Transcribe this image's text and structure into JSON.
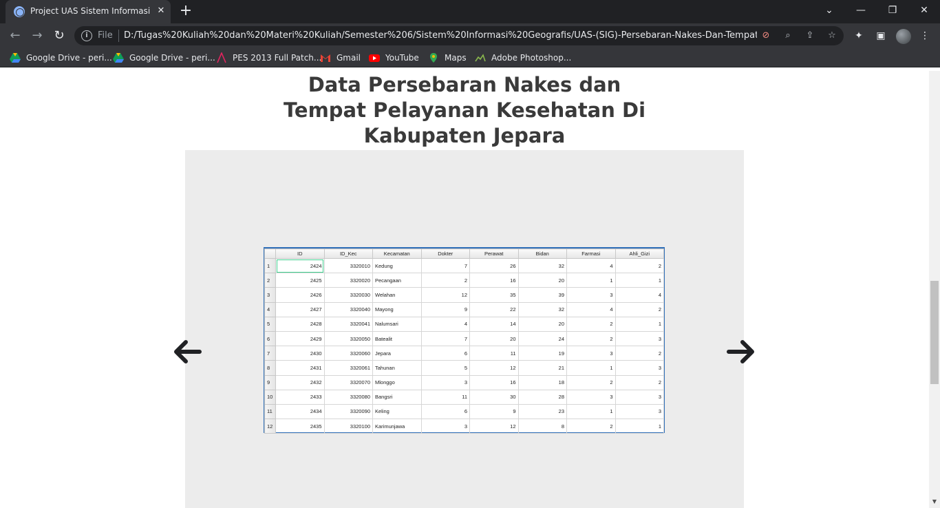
{
  "browser": {
    "tab_title": "Project UAS Sistem Informasi Geografis",
    "close_glyph": "✕",
    "new_tab_glyph": "+",
    "url_scheme": "File",
    "url": "D:/Tugas%20Kuliah%20dan%20Materi%20Kuliah/Semester%206/Sistem%20Informasi%20Geografis/UAS-(SIG)-Persebaran-Nakes-Dan-Tempat-Pelayanan-Kesehatan/index.html",
    "bookmarks": [
      {
        "label": "Google Drive - peri...",
        "icon": "google-drive-icon"
      },
      {
        "label": "Google Drive - peri...",
        "icon": "google-drive-icon"
      },
      {
        "label": "PES 2013 Full Patch...",
        "icon": "pes-icon"
      },
      {
        "label": "Gmail",
        "icon": "gmail-icon"
      },
      {
        "label": "YouTube",
        "icon": "youtube-icon"
      },
      {
        "label": "Maps",
        "icon": "maps-icon"
      },
      {
        "label": "Adobe Photoshop...",
        "icon": "photoshop-icon"
      }
    ],
    "accent": "#8ab4f8"
  },
  "page": {
    "heading": "Data Persebaran Nakes dan Tempat Pelayanan Kesehatan Di Kabupaten Jepara",
    "carousel_prev_icon": "arrow-left-icon",
    "carousel_next_icon": "arrow-right-icon"
  },
  "table": {
    "columns": [
      "ID",
      "ID_Kec",
      "Kecamatan",
      "Dokter",
      "Perawat",
      "Bidan",
      "Farmasi",
      "Ahli_Gizi"
    ],
    "rows": [
      [
        "1",
        "2424",
        "3320010",
        "Kedung",
        "7",
        "26",
        "32",
        "4",
        "2"
      ],
      [
        "2",
        "2425",
        "3320020",
        "Pecangaan",
        "2",
        "16",
        "20",
        "1",
        "1"
      ],
      [
        "3",
        "2426",
        "3320030",
        "Welahan",
        "12",
        "35",
        "39",
        "3",
        "4"
      ],
      [
        "4",
        "2427",
        "3320040",
        "Mayong",
        "9",
        "22",
        "32",
        "4",
        "2"
      ],
      [
        "5",
        "2428",
        "3320041",
        "Nalumsari",
        "4",
        "14",
        "20",
        "2",
        "1"
      ],
      [
        "6",
        "2429",
        "3320050",
        "Batealit",
        "7",
        "20",
        "24",
        "2",
        "3"
      ],
      [
        "7",
        "2430",
        "3320060",
        "Jepara",
        "6",
        "11",
        "19",
        "3",
        "2"
      ],
      [
        "8",
        "2431",
        "3320061",
        "Tahunan",
        "5",
        "12",
        "21",
        "1",
        "3"
      ],
      [
        "9",
        "2432",
        "3320070",
        "Mlonggo",
        "3",
        "16",
        "18",
        "2",
        "2"
      ],
      [
        "10",
        "2433",
        "3320080",
        "Bangsri",
        "11",
        "30",
        "28",
        "3",
        "3"
      ],
      [
        "11",
        "2434",
        "3320090",
        "Keling",
        "6",
        "9",
        "23",
        "1",
        "3"
      ],
      [
        "12",
        "2435",
        "3320100",
        "Karimunjawa",
        "3",
        "12",
        "8",
        "2",
        "1"
      ]
    ]
  }
}
